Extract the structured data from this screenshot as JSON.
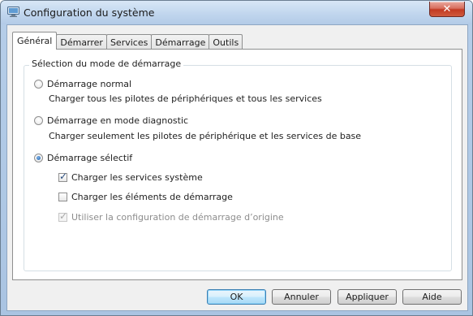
{
  "window": {
    "title": "Configuration du système",
    "close_label": "✕"
  },
  "tabs": [
    {
      "label": "Général",
      "active": true
    },
    {
      "label": "Démarrer",
      "active": false
    },
    {
      "label": "Services",
      "active": false
    },
    {
      "label": "Démarrage",
      "active": false
    },
    {
      "label": "Outils",
      "active": false
    }
  ],
  "startup_group": {
    "legend": "Sélection du mode de démarrage",
    "normal": {
      "label": "Démarrage normal",
      "description": "Charger tous les pilotes de périphériques et tous les services",
      "selected": false
    },
    "diagnostic": {
      "label": "Démarrage en mode diagnostic",
      "description": "Charger seulement les pilotes de périphérique et les services de base",
      "selected": false
    },
    "selective": {
      "label": "Démarrage sélectif",
      "selected": true,
      "options": {
        "system_services": {
          "label": "Charger les services système",
          "checked": true,
          "enabled": true
        },
        "startup_items": {
          "label": "Charger les éléments de démarrage",
          "checked": false,
          "enabled": true
        },
        "original_config": {
          "label": "Utiliser la configuration de démarrage d’origine",
          "checked": true,
          "enabled": false
        }
      }
    }
  },
  "buttons": {
    "ok": "OK",
    "cancel": "Annuler",
    "apply": "Appliquer",
    "help": "Aide"
  },
  "colors": {
    "frame": "#b5cde8",
    "close": "#c23a22",
    "radio_dot": "#1c5fa8",
    "default_button": "#3c7fb1"
  }
}
